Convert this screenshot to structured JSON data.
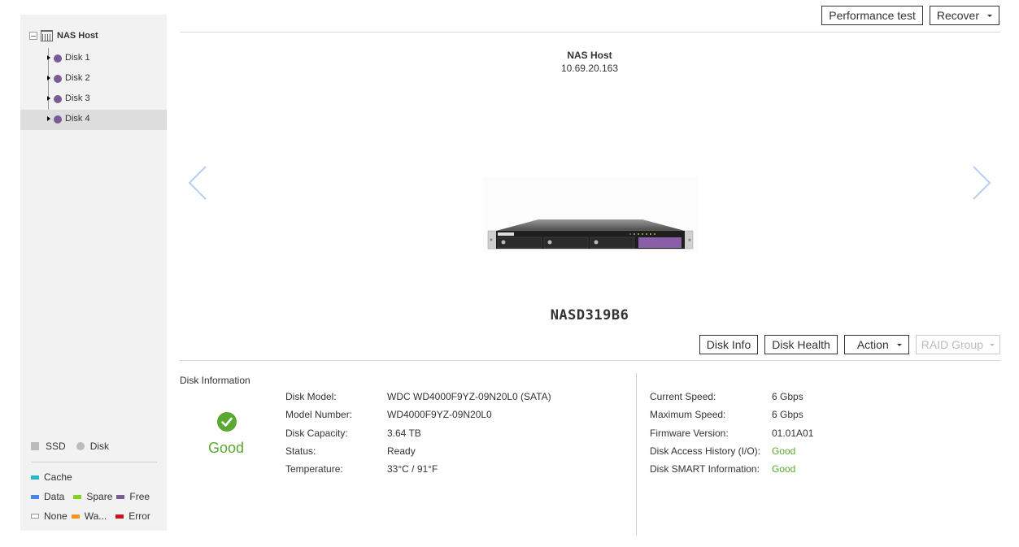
{
  "sidebar": {
    "root": {
      "label": "NAS Host",
      "icon": "nas-host-icon",
      "expanded": true
    },
    "items": [
      {
        "label": "Disk 1",
        "icon": "disk-dot-icon",
        "color": "#7b5b93",
        "selected": false
      },
      {
        "label": "Disk 2",
        "icon": "disk-dot-icon",
        "color": "#7b5b93",
        "selected": false
      },
      {
        "label": "Disk 3",
        "icon": "disk-dot-icon",
        "color": "#7b5b93",
        "selected": false
      },
      {
        "label": "Disk 4",
        "icon": "disk-dot-icon",
        "color": "#7b5b93",
        "selected": true
      }
    ],
    "legend": {
      "types": [
        {
          "label": "SSD",
          "shape": "square",
          "color": "#bbbbbb"
        },
        {
          "label": "Disk",
          "shape": "circle",
          "color": "#bbbbbb"
        }
      ],
      "statuses": [
        {
          "label": "Cache",
          "color": "#26b5c9"
        },
        {
          "label": "Data",
          "color": "#4a85e8"
        },
        {
          "label": "Spare",
          "color": "#7ed321"
        },
        {
          "label": "Free",
          "color": "#7b5b93"
        },
        {
          "label": "None",
          "color": "#ffffff"
        },
        {
          "label": "Wa...",
          "color": "#f7941d"
        },
        {
          "label": "Error",
          "color": "#c8171e"
        }
      ]
    }
  },
  "toolbar": {
    "performance_test_label": "Performance test",
    "recover_label": "Recover"
  },
  "host": {
    "name": "NAS Host",
    "ip": "10.69.20.163",
    "model": "NASD319B6"
  },
  "disk_actions": {
    "disk_info_label": "Disk Info",
    "disk_health_label": "Disk Health",
    "action_label": "Action",
    "raid_group_label": "RAID Group"
  },
  "disk_information": {
    "title": "Disk Information",
    "health": "Good",
    "left": [
      {
        "label": "Disk Model:",
        "value": "WDC WD4000F9YZ-09N20L0 (SATA)"
      },
      {
        "label": "Model Number:",
        "value": "WD4000F9YZ-09N20L0"
      },
      {
        "label": "Disk Capacity:",
        "value": "3.64 TB"
      },
      {
        "label": "Status:",
        "value": "Ready"
      },
      {
        "label": "Temperature:",
        "value": "33°C / 91°F"
      }
    ],
    "right": [
      {
        "label": "Current Speed:",
        "value": "6 Gbps"
      },
      {
        "label": "Maximum Speed:",
        "value": "6 Gbps"
      },
      {
        "label": "Firmware Version:",
        "value": "01.01A01"
      },
      {
        "label": "Disk Access History (I/O):",
        "value": "Good"
      },
      {
        "label": "Disk SMART Information:",
        "value": "Good"
      }
    ]
  },
  "colors": {
    "good": "#5aa832",
    "disk_free": "#7b5b93",
    "nav_arrow": "#b8cff5"
  }
}
